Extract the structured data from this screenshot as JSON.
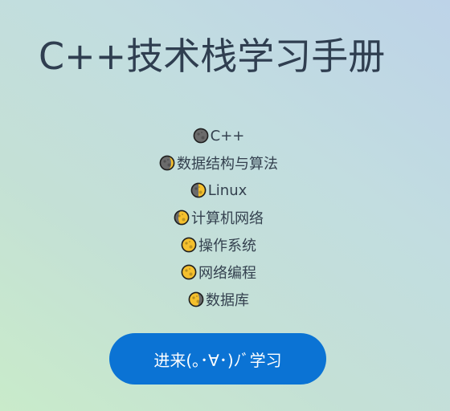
{
  "header": {
    "title": "C++技术栈学习手册"
  },
  "topics": [
    {
      "label": "C++",
      "icon": "new-moon-icon"
    },
    {
      "label": "数据结构与算法",
      "icon": "waxing-crescent-moon-icon"
    },
    {
      "label": "Linux",
      "icon": "first-quarter-moon-icon"
    },
    {
      "label": "计算机网络",
      "icon": "waxing-gibbous-moon-icon"
    },
    {
      "label": "操作系统",
      "icon": "full-moon-icon"
    },
    {
      "label": "网络编程",
      "icon": "full-moon-icon"
    },
    {
      "label": "数据库",
      "icon": "waning-gibbous-moon-icon"
    }
  ],
  "start_button": {
    "label": "进来(｡･∀･)ﾉﾞ学习"
  },
  "colors": {
    "title_text": "#2f3e50",
    "body_text": "#34414f",
    "button_bg": "#0b73d4",
    "button_text": "#ffffff",
    "moon_dark": "#6b6b6b",
    "moon_light": "#f5c02d",
    "moon_outline": "#1e1e1e"
  }
}
